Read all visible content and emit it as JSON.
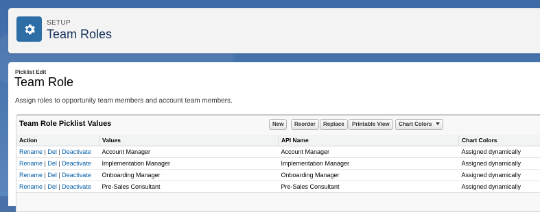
{
  "header": {
    "eyebrow": "SETUP",
    "title": "Team Roles",
    "icon": "gear-icon",
    "accent_color": "#2e6ea6"
  },
  "picklist": {
    "label": "Picklist Edit",
    "title": "Team Role",
    "description": "Assign roles to opportunity team members and account team members."
  },
  "values_panel": {
    "title": "Team Role Picklist Values",
    "buttons": {
      "new": "New",
      "reorder": "Reorder",
      "replace": "Replace",
      "printable_view": "Printable View",
      "chart_colors": "Chart Colors"
    },
    "columns": [
      "Action",
      "Values",
      "API Name",
      "Chart Colors"
    ],
    "actions": {
      "rename": "Rename",
      "del": "Del",
      "deactivate": "Deactivate",
      "separator": "|"
    },
    "rows": [
      {
        "value": "Account Manager",
        "api_name": "Account Manager",
        "chart_color": "Assigned dynamically"
      },
      {
        "value": "Implementation Manager",
        "api_name": "Implementation Manager",
        "chart_color": "Assigned dynamically"
      },
      {
        "value": "Onboarding Manager",
        "api_name": "Onboarding Manager",
        "chart_color": "Assigned dynamically"
      },
      {
        "value": "Pre-Sales Consultant",
        "api_name": "Pre-Sales Consultant",
        "chart_color": "Assigned dynamically"
      }
    ]
  }
}
